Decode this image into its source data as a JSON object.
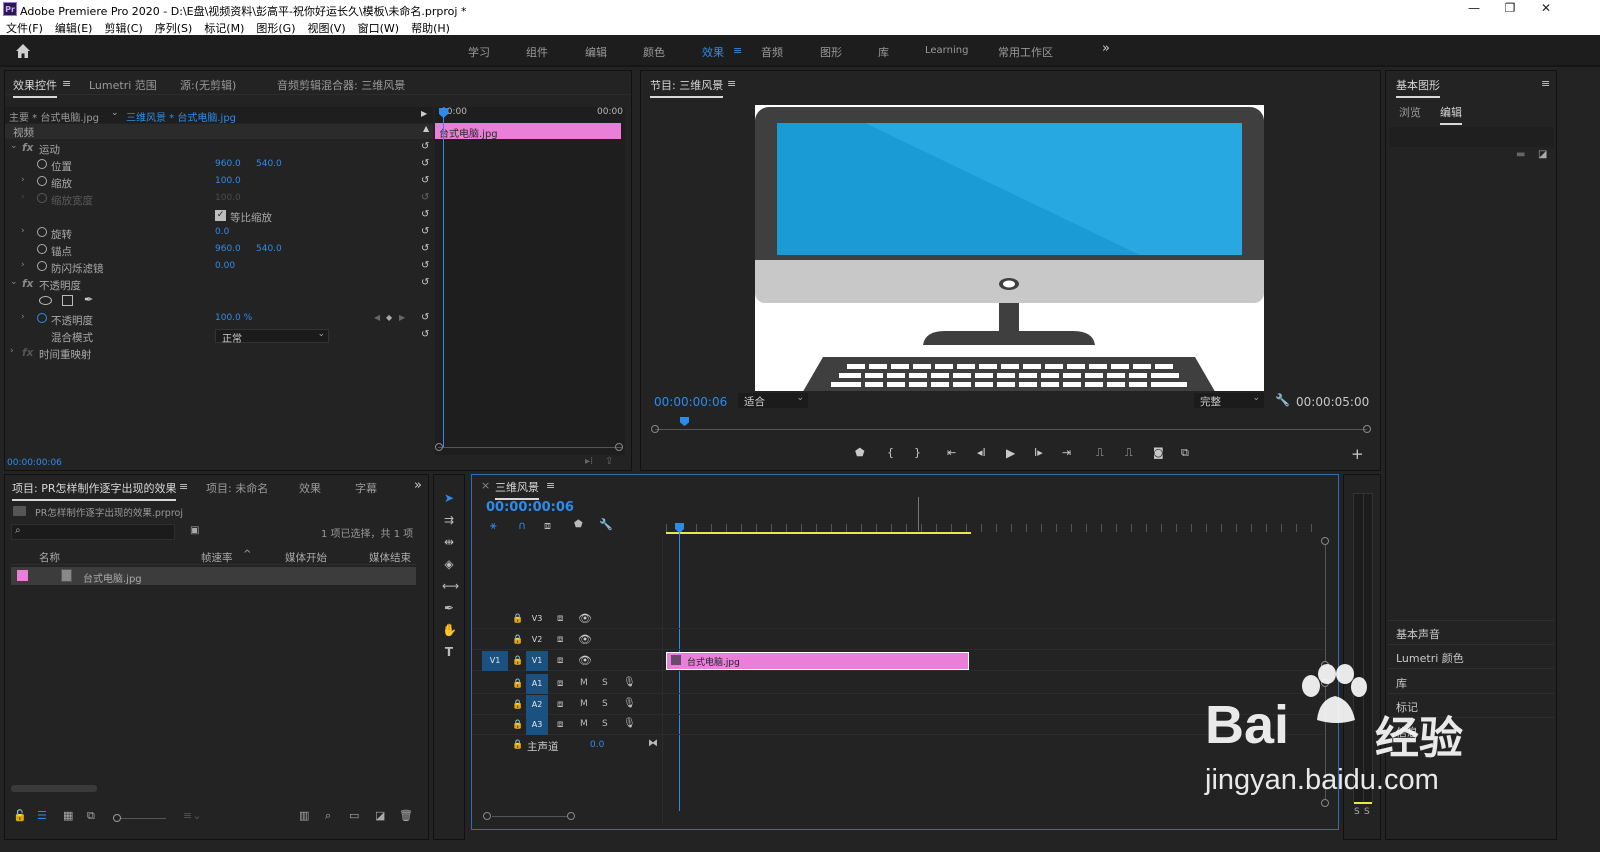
{
  "app": {
    "logo": "Pr",
    "title": "Adobe Premiere Pro 2020 - D:\\E盘\\视频资料\\彭高平-祝你好运长久\\模板\\未命名.prproj *",
    "minimize": "—",
    "maximize": "❐",
    "close": "✕"
  },
  "menu": [
    "文件(F)",
    "编辑(E)",
    "剪辑(C)",
    "序列(S)",
    "标记(M)",
    "图形(G)",
    "视图(V)",
    "窗口(W)",
    "帮助(H)"
  ],
  "workspaces": [
    "学习",
    "组件",
    "编辑",
    "颜色",
    "效果",
    "音频",
    "图形",
    "库",
    "Learning",
    "常用工作区"
  ],
  "workspace_active": "效果",
  "workspace_more": "»",
  "effect_controls": {
    "tabs": [
      "效果控件",
      "Lumetri 范围",
      "源:(无剪辑)",
      "音频剪辑混合器: 三维风景"
    ],
    "master": "主要 * 台式电脑.jpg",
    "sequence": "三维风景 * 台式电脑.jpg",
    "time_start": "00:00",
    "time_end": "00:00",
    "clip_label": "台式电脑.jpg",
    "section_video": "视频",
    "motion": "运动",
    "position": "位置",
    "pos_x": "960.0",
    "pos_y": "540.0",
    "scale": "缩放",
    "scale_v": "100.0",
    "scale_width": "缩放宽度",
    "scale_width_v": "100.0",
    "uniform_scale": "等比缩放",
    "rotation": "旋转",
    "rotation_v": "0.0",
    "anchor": "锚点",
    "anchor_x": "960.0",
    "anchor_y": "540.0",
    "anti_flicker": "防闪烁滤镜",
    "anti_flicker_v": "0.00",
    "opacity_fx": "不透明度",
    "opacity": "不透明度",
    "opacity_v": "100.0 %",
    "blend": "混合模式",
    "blend_v": "正常",
    "time_remap": "时间重映射",
    "timecode": "00:00:00:06"
  },
  "program": {
    "title": "节目: 三维风景",
    "timecode": "00:00:00:06",
    "fit": "适合",
    "quality": "完整",
    "duration": "00:00:05:00"
  },
  "essential_graphics": {
    "title": "基本图形",
    "tabs": [
      "浏览",
      "编辑"
    ],
    "items": [
      "基本声音",
      "Lumetri 颜色",
      "库",
      "标记",
      "信息"
    ]
  },
  "project": {
    "tabs": [
      "项目: PR怎样制作逐字出现的效果",
      "项目: 未命名",
      "效果",
      "字幕"
    ],
    "file": "PR怎样制作逐字出现的效果.prproj",
    "selection": "1 项已选择，共 1 项",
    "cols": [
      "名称",
      "帧速率",
      "媒体开始",
      "媒体结束"
    ],
    "items": [
      {
        "name": "台式电脑.jpg",
        "color": "#e97fd9"
      }
    ]
  },
  "timeline": {
    "title": "三维风景",
    "timecode": "00:00:00:06",
    "video_tracks": [
      "V3",
      "V2",
      "V1"
    ],
    "audio_tracks": [
      "A1",
      "A2",
      "A3"
    ],
    "source_patch_v": "V1",
    "master": "主声道",
    "master_v": "0.0",
    "clip": "台式电脑.jpg",
    "mute": "M",
    "solo": "S"
  },
  "meter": {
    "labels": [
      "S",
      "S"
    ]
  },
  "watermark": {
    "brand": "Bai",
    "brand2": "经验",
    "url": "jingyan.baidu.com"
  },
  "colors": {
    "accent": "#2d8ceb",
    "clip": "#e97fd9",
    "screen": "#1a9bd6"
  }
}
